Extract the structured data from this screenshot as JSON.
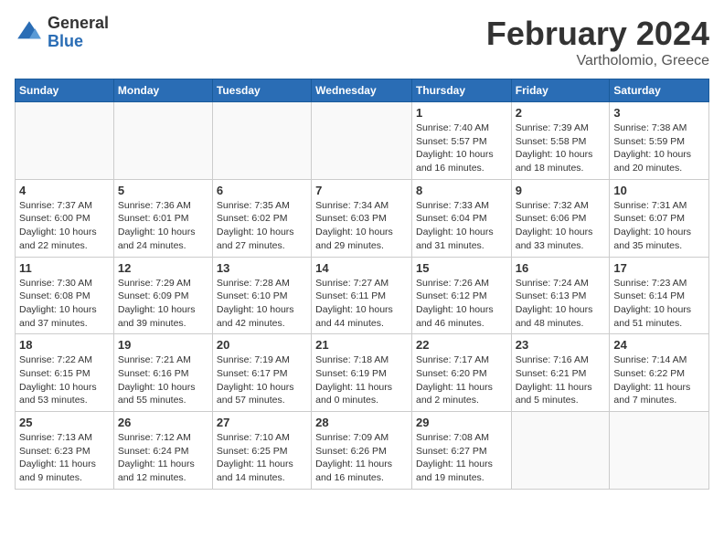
{
  "logo": {
    "general": "General",
    "blue": "Blue"
  },
  "title": "February 2024",
  "location": "Vartholomio, Greece",
  "days_of_week": [
    "Sunday",
    "Monday",
    "Tuesday",
    "Wednesday",
    "Thursday",
    "Friday",
    "Saturday"
  ],
  "weeks": [
    [
      {
        "day": "",
        "info": ""
      },
      {
        "day": "",
        "info": ""
      },
      {
        "day": "",
        "info": ""
      },
      {
        "day": "",
        "info": ""
      },
      {
        "day": "1",
        "info": "Sunrise: 7:40 AM\nSunset: 5:57 PM\nDaylight: 10 hours\nand 16 minutes."
      },
      {
        "day": "2",
        "info": "Sunrise: 7:39 AM\nSunset: 5:58 PM\nDaylight: 10 hours\nand 18 minutes."
      },
      {
        "day": "3",
        "info": "Sunrise: 7:38 AM\nSunset: 5:59 PM\nDaylight: 10 hours\nand 20 minutes."
      }
    ],
    [
      {
        "day": "4",
        "info": "Sunrise: 7:37 AM\nSunset: 6:00 PM\nDaylight: 10 hours\nand 22 minutes."
      },
      {
        "day": "5",
        "info": "Sunrise: 7:36 AM\nSunset: 6:01 PM\nDaylight: 10 hours\nand 24 minutes."
      },
      {
        "day": "6",
        "info": "Sunrise: 7:35 AM\nSunset: 6:02 PM\nDaylight: 10 hours\nand 27 minutes."
      },
      {
        "day": "7",
        "info": "Sunrise: 7:34 AM\nSunset: 6:03 PM\nDaylight: 10 hours\nand 29 minutes."
      },
      {
        "day": "8",
        "info": "Sunrise: 7:33 AM\nSunset: 6:04 PM\nDaylight: 10 hours\nand 31 minutes."
      },
      {
        "day": "9",
        "info": "Sunrise: 7:32 AM\nSunset: 6:06 PM\nDaylight: 10 hours\nand 33 minutes."
      },
      {
        "day": "10",
        "info": "Sunrise: 7:31 AM\nSunset: 6:07 PM\nDaylight: 10 hours\nand 35 minutes."
      }
    ],
    [
      {
        "day": "11",
        "info": "Sunrise: 7:30 AM\nSunset: 6:08 PM\nDaylight: 10 hours\nand 37 minutes."
      },
      {
        "day": "12",
        "info": "Sunrise: 7:29 AM\nSunset: 6:09 PM\nDaylight: 10 hours\nand 39 minutes."
      },
      {
        "day": "13",
        "info": "Sunrise: 7:28 AM\nSunset: 6:10 PM\nDaylight: 10 hours\nand 42 minutes."
      },
      {
        "day": "14",
        "info": "Sunrise: 7:27 AM\nSunset: 6:11 PM\nDaylight: 10 hours\nand 44 minutes."
      },
      {
        "day": "15",
        "info": "Sunrise: 7:26 AM\nSunset: 6:12 PM\nDaylight: 10 hours\nand 46 minutes."
      },
      {
        "day": "16",
        "info": "Sunrise: 7:24 AM\nSunset: 6:13 PM\nDaylight: 10 hours\nand 48 minutes."
      },
      {
        "day": "17",
        "info": "Sunrise: 7:23 AM\nSunset: 6:14 PM\nDaylight: 10 hours\nand 51 minutes."
      }
    ],
    [
      {
        "day": "18",
        "info": "Sunrise: 7:22 AM\nSunset: 6:15 PM\nDaylight: 10 hours\nand 53 minutes."
      },
      {
        "day": "19",
        "info": "Sunrise: 7:21 AM\nSunset: 6:16 PM\nDaylight: 10 hours\nand 55 minutes."
      },
      {
        "day": "20",
        "info": "Sunrise: 7:19 AM\nSunset: 6:17 PM\nDaylight: 10 hours\nand 57 minutes."
      },
      {
        "day": "21",
        "info": "Sunrise: 7:18 AM\nSunset: 6:19 PM\nDaylight: 11 hours\nand 0 minutes."
      },
      {
        "day": "22",
        "info": "Sunrise: 7:17 AM\nSunset: 6:20 PM\nDaylight: 11 hours\nand 2 minutes."
      },
      {
        "day": "23",
        "info": "Sunrise: 7:16 AM\nSunset: 6:21 PM\nDaylight: 11 hours\nand 5 minutes."
      },
      {
        "day": "24",
        "info": "Sunrise: 7:14 AM\nSunset: 6:22 PM\nDaylight: 11 hours\nand 7 minutes."
      }
    ],
    [
      {
        "day": "25",
        "info": "Sunrise: 7:13 AM\nSunset: 6:23 PM\nDaylight: 11 hours\nand 9 minutes."
      },
      {
        "day": "26",
        "info": "Sunrise: 7:12 AM\nSunset: 6:24 PM\nDaylight: 11 hours\nand 12 minutes."
      },
      {
        "day": "27",
        "info": "Sunrise: 7:10 AM\nSunset: 6:25 PM\nDaylight: 11 hours\nand 14 minutes."
      },
      {
        "day": "28",
        "info": "Sunrise: 7:09 AM\nSunset: 6:26 PM\nDaylight: 11 hours\nand 16 minutes."
      },
      {
        "day": "29",
        "info": "Sunrise: 7:08 AM\nSunset: 6:27 PM\nDaylight: 11 hours\nand 19 minutes."
      },
      {
        "day": "",
        "info": ""
      },
      {
        "day": "",
        "info": ""
      }
    ]
  ]
}
